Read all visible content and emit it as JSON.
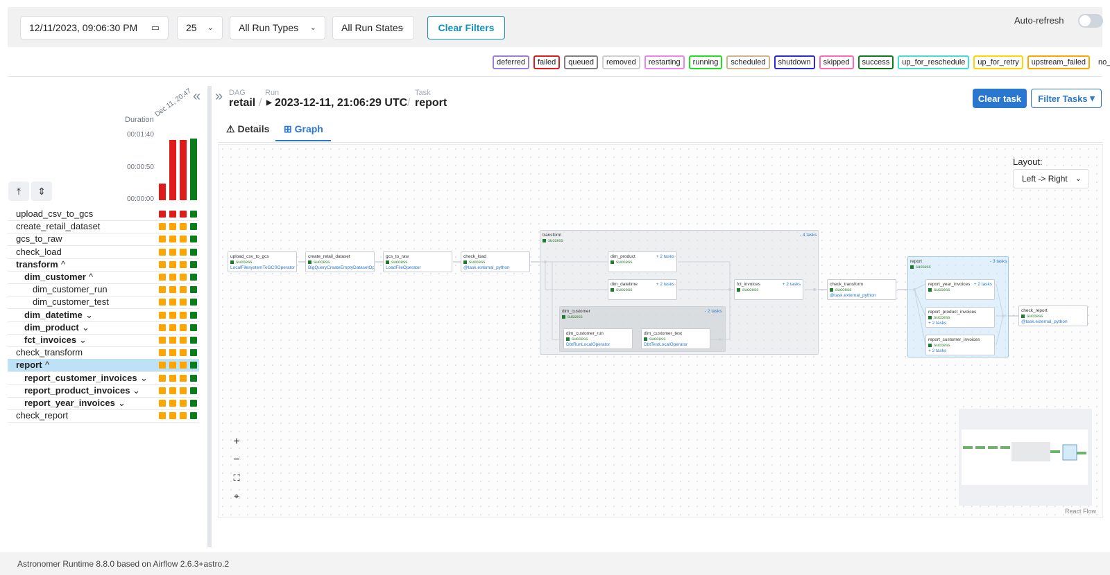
{
  "filters": {
    "datetime": "12/11/2023, 09:06:30 PM",
    "num_runs": "25",
    "run_types": "All Run Types",
    "run_states": "All Run States",
    "clear_label": "Clear Filters",
    "auto_refresh_label": "Auto-refresh"
  },
  "states": [
    "deferred",
    "failed",
    "queued",
    "removed",
    "restarting",
    "running",
    "scheduled",
    "shutdown",
    "skipped",
    "success",
    "up_for_reschedule",
    "up_for_retry",
    "upstream_failed",
    "no_status"
  ],
  "state_colors": {
    "deferred": "#9b7fd6",
    "failed": "#e01b1b",
    "queued": "#808080",
    "removed": "#cfcfcf",
    "restarting": "#ee82ee",
    "running": "#1fe01f",
    "scheduled": "#d2b48c",
    "shutdown": "#2b2bd6",
    "skipped": "#ff69b4",
    "success": "#0a7d1a",
    "up_for_reschedule": "#40e0d0",
    "up_for_retry": "#ffd700",
    "upstream_failed": "#ffa500",
    "no_status": "#ffffff"
  },
  "grid": {
    "duration_label": "Duration",
    "date_label": "Dec 11, 20:47",
    "duration_ticks": [
      "00:01:40",
      "00:00:50",
      "00:00:00"
    ],
    "durations_sec": [
      25,
      93,
      93,
      95
    ],
    "run_colors": [
      "#e01b1b",
      "#e01b1b",
      "#e01b1b",
      "#0a7d1a"
    ],
    "tasks": [
      {
        "label": "upload_csv_to_gcs",
        "bold": false,
        "indent": 0,
        "suffix": "",
        "colors": [
          "#e01b1b",
          "#e01b1b",
          "#e01b1b",
          "#0a7d1a"
        ]
      },
      {
        "label": "create_retail_dataset",
        "bold": false,
        "indent": 0,
        "suffix": "",
        "colors": [
          "#ffa500",
          "#ffa500",
          "#ffa500",
          "#0a7d1a"
        ]
      },
      {
        "label": "gcs_to_raw",
        "bold": false,
        "indent": 0,
        "suffix": "",
        "colors": [
          "#ffa500",
          "#ffa500",
          "#ffa500",
          "#0a7d1a"
        ]
      },
      {
        "label": "check_load",
        "bold": false,
        "indent": 0,
        "suffix": "",
        "colors": [
          "#ffa500",
          "#ffa500",
          "#ffa500",
          "#0a7d1a"
        ]
      },
      {
        "label": "transform",
        "bold": true,
        "indent": 0,
        "suffix": "^",
        "colors": [
          "#ffa500",
          "#ffa500",
          "#ffa500",
          "#0a7d1a"
        ]
      },
      {
        "label": "dim_customer",
        "bold": true,
        "indent": 1,
        "suffix": "^",
        "colors": [
          "#ffa500",
          "#ffa500",
          "#ffa500",
          "#0a7d1a"
        ]
      },
      {
        "label": "dim_customer_run",
        "bold": false,
        "indent": 2,
        "suffix": "",
        "colors": [
          "#ffa500",
          "#ffa500",
          "#ffa500",
          "#0a7d1a"
        ]
      },
      {
        "label": "dim_customer_test",
        "bold": false,
        "indent": 2,
        "suffix": "",
        "colors": [
          "#ffa500",
          "#ffa500",
          "#ffa500",
          "#0a7d1a"
        ]
      },
      {
        "label": "dim_datetime",
        "bold": true,
        "indent": 1,
        "suffix": "⌄",
        "colors": [
          "#ffa500",
          "#ffa500",
          "#ffa500",
          "#0a7d1a"
        ]
      },
      {
        "label": "dim_product",
        "bold": true,
        "indent": 1,
        "suffix": "⌄",
        "colors": [
          "#ffa500",
          "#ffa500",
          "#ffa500",
          "#0a7d1a"
        ]
      },
      {
        "label": "fct_invoices",
        "bold": true,
        "indent": 1,
        "suffix": "⌄",
        "colors": [
          "#ffa500",
          "#ffa500",
          "#ffa500",
          "#0a7d1a"
        ]
      },
      {
        "label": "check_transform",
        "bold": false,
        "indent": 0,
        "suffix": "",
        "colors": [
          "#ffa500",
          "#ffa500",
          "#ffa500",
          "#0a7d1a"
        ]
      },
      {
        "label": "report",
        "bold": true,
        "indent": 0,
        "suffix": "^",
        "selected": true,
        "colors": [
          "#ffa500",
          "#ffa500",
          "#ffa500",
          "#0a7d1a"
        ]
      },
      {
        "label": "report_customer_invoices",
        "bold": true,
        "indent": 1,
        "suffix": "⌄",
        "colors": [
          "#ffa500",
          "#ffa500",
          "#ffa500",
          "#0a7d1a"
        ]
      },
      {
        "label": "report_product_invoices",
        "bold": true,
        "indent": 1,
        "suffix": "⌄",
        "colors": [
          "#ffa500",
          "#ffa500",
          "#ffa500",
          "#0a7d1a"
        ]
      },
      {
        "label": "report_year_invoices",
        "bold": true,
        "indent": 1,
        "suffix": "⌄",
        "colors": [
          "#ffa500",
          "#ffa500",
          "#ffa500",
          "#0a7d1a"
        ]
      },
      {
        "label": "check_report",
        "bold": false,
        "indent": 0,
        "suffix": "",
        "colors": [
          "#ffa500",
          "#ffa500",
          "#ffa500",
          "#0a7d1a"
        ]
      }
    ]
  },
  "breadcrumb": {
    "dag_label": "DAG",
    "dag": "retail",
    "run_label": "Run",
    "run": "2023-12-11, 21:06:29 UTC",
    "task_label": "Task",
    "task": "report"
  },
  "actions": {
    "clear_task": "Clear task",
    "filter_tasks": "Filter Tasks"
  },
  "tabs": {
    "details": "Details",
    "graph": "Graph"
  },
  "graph": {
    "layout_label": "Layout:",
    "layout_value": "Left -> Right",
    "react_flow": "React Flow",
    "success": "success",
    "nodes": {
      "upload": {
        "name": "upload_csv_to_gcs",
        "op": "LocalFilesystemToGCSOperator"
      },
      "create": {
        "name": "create_retail_dataset",
        "op": "BigQueryCreateEmptyDatasetOperator"
      },
      "gcs": {
        "name": "gcs_to_raw",
        "op": "LoadFileOperator"
      },
      "check_load": {
        "name": "check_load",
        "op": "@task.external_python"
      },
      "dim_product": {
        "name": "dim_product",
        "count": "+ 2 tasks"
      },
      "dim_datetime": {
        "name": "dim_datetime",
        "count": "+ 2 tasks"
      },
      "fct_invoices": {
        "name": "fct_invoices",
        "count": "+ 2 tasks"
      },
      "dim_customer_run": {
        "name": "dim_customer_run",
        "op": "DbtRunLocalOperator"
      },
      "dim_customer_test": {
        "name": "dim_customer_test",
        "op": "DbtTestLocalOperator"
      },
      "check_transform": {
        "name": "check_transform",
        "op": "@task.external_python"
      },
      "report_year": {
        "name": "report_year_invoices",
        "count": "+ 2 tasks"
      },
      "report_product": {
        "name": "report_product_invoices",
        "extra": "+ 2 tasks"
      },
      "report_customer": {
        "name": "report_customer_invoices",
        "extra": "+ 2 tasks"
      },
      "check_report": {
        "name": "check_report",
        "op": "@task.external_python"
      }
    },
    "groups": {
      "transform": {
        "name": "transform",
        "count": "- 4 tasks"
      },
      "dim_customer": {
        "name": "dim_customer",
        "count": "- 2 tasks"
      },
      "report": {
        "name": "report",
        "count": "- 3 tasks"
      }
    }
  },
  "footer": "Astronomer Runtime 8.8.0 based on Airflow 2.6.3+astro.2"
}
